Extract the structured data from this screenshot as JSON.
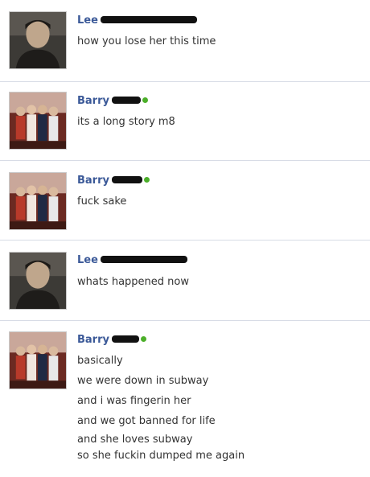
{
  "messages": [
    {
      "sender": "Lee",
      "status_dot": false,
      "avatar": "avatar-lee",
      "lines": [
        "how you lose her this time"
      ]
    },
    {
      "sender": "Barry",
      "status_dot": true,
      "avatar": "avatar-barry-group",
      "lines": [
        "its a long story m8"
      ]
    },
    {
      "sender": "Barry",
      "status_dot": true,
      "avatar": "avatar-barry-group",
      "lines": [
        "fuck sake"
      ]
    },
    {
      "sender": "Lee",
      "status_dot": false,
      "avatar": "avatar-lee",
      "lines": [
        "whats happened now"
      ]
    },
    {
      "sender": "Barry",
      "status_dot": true,
      "avatar": "avatar-barry-group",
      "lines": [
        "basically",
        "we were down in subway",
        "and i was fingerin her",
        "and we got banned for life",
        "and she loves subway",
        "so she fuckin dumped me again"
      ]
    }
  ],
  "colors": {
    "name": "#3b5998",
    "online_dot": "#4caf2a",
    "divider": "#d8dce6"
  }
}
